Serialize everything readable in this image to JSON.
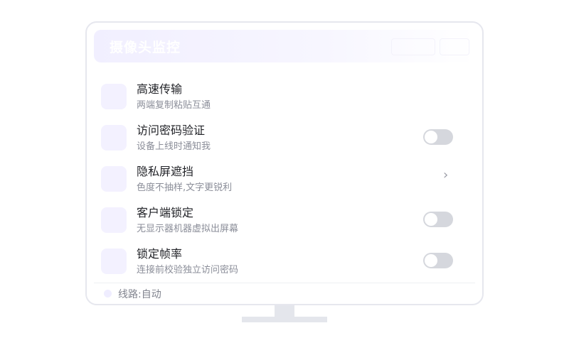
{
  "header": {
    "title": "摄像头监控"
  },
  "settings": {
    "items": [
      {
        "title": "高速传输",
        "subtitle": "两端复制粘贴互通",
        "control": "none"
      },
      {
        "title": "访问密码验证",
        "subtitle": "设备上线时通知我",
        "control": "toggle",
        "on": false
      },
      {
        "title": "隐私屏遮挡",
        "subtitle": "色度不抽样,文字更锐利",
        "control": "chevron"
      },
      {
        "title": "客户端锁定",
        "subtitle": "无显示器机器虚拟出屏幕",
        "control": "toggle",
        "on": false
      },
      {
        "title": "锁定帧率",
        "subtitle": "连接前校验独立访问密码",
        "control": "toggle",
        "on": false
      }
    ]
  },
  "footer": {
    "route_label": "线路:自动"
  },
  "colors": {
    "accent_light": "#f3f1ff",
    "toggle_off": "#d5d7dd",
    "border": "#e6e7ee"
  },
  "icons": {
    "chevron": "chevron-right-icon"
  }
}
